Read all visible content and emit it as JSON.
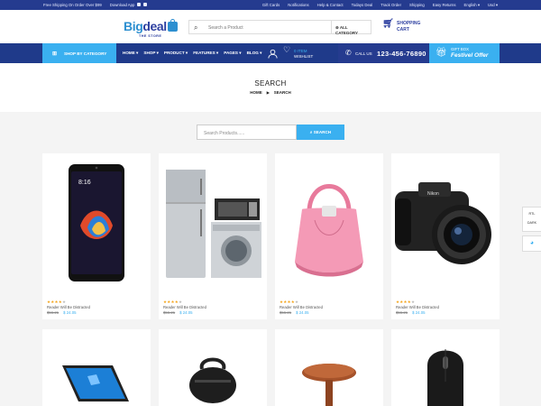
{
  "topbar": {
    "shipping": "Free Shipping On Order Over $99",
    "download_app": "Download App",
    "links": [
      "Gift Cards",
      "Notifications",
      "Help & Contact",
      "Todays Deal",
      "Track Order",
      "Shipping",
      "Easy Returns",
      "English",
      "Usd"
    ]
  },
  "header": {
    "logo_part1": "Big",
    "logo_part2": "deal",
    "tagline": "THE STORE",
    "search_placeholder": "Search a Product",
    "category_label": "ALL CATEGORY",
    "cart_line1": "SHOPPING",
    "cart_line2": "CART"
  },
  "nav": {
    "shop_by_category": "SHOP BY CATEGORY",
    "menu": [
      "HOME",
      "SHOP",
      "PRODUCT",
      "FEATURES",
      "PAGES",
      "BLOG"
    ],
    "wishlist_count": "0 ITEM",
    "wishlist_label": "WISHLIST",
    "call_label": "CALL US",
    "phone": "123-456-76890",
    "gift_small": "GIFT BOX",
    "gift_big": "Festivel Offer"
  },
  "page": {
    "title": "SEARCH",
    "breadcrumb": [
      "HOME",
      "SEARCH"
    ]
  },
  "search": {
    "placeholder": "Search Products......",
    "button_label": "SEARCH"
  },
  "products": [
    {
      "name": "Reader Will Be Distracted",
      "old_price": "$56.21",
      "price": "$ 24.05",
      "rating": 4,
      "icon": "smartphone"
    },
    {
      "name": "Reader Will Be Distracted",
      "old_price": "$56.21",
      "price": "$ 24.05",
      "rating": 4,
      "icon": "home-appliances"
    },
    {
      "name": "Reader Will Be Distracted",
      "old_price": "$56.21",
      "price": "$ 24.05",
      "rating": 4,
      "icon": "handbag"
    },
    {
      "name": "Reader Will Be Distracted",
      "old_price": "$56.21",
      "price": "$ 24.05",
      "rating": 4,
      "icon": "dslr-camera"
    }
  ],
  "products_row2": [
    {
      "icon": "laptop"
    },
    {
      "icon": "pot"
    },
    {
      "icon": "side-table"
    },
    {
      "icon": "computer-mouse"
    }
  ],
  "side_panel": {
    "rtl": "RTL",
    "dark": "DARK"
  },
  "colors": {
    "topbar": "#253b8f",
    "nav": "#1f3a8a",
    "accent": "#3ab0f0",
    "star": "#f4a51c"
  }
}
